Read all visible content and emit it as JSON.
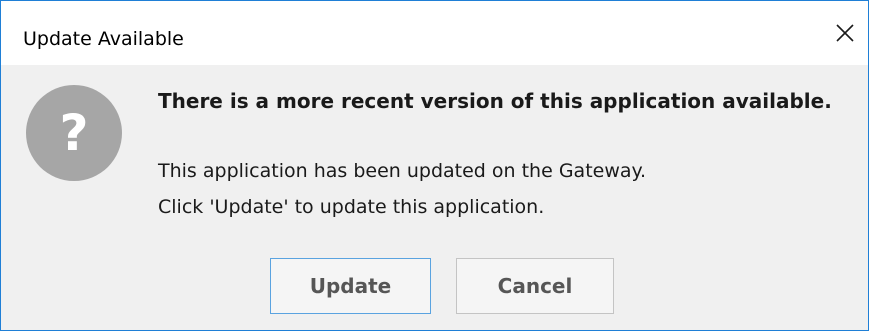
{
  "dialog": {
    "title": "Update Available",
    "close_icon": "close-icon",
    "icon": "question-icon",
    "icon_glyph": "?",
    "headline": "There is a more recent version of this application available.",
    "message_lines": [
      "This application has been updated on the Gateway.",
      "Click 'Update' to update this application."
    ],
    "buttons": {
      "update_label": "Update",
      "cancel_label": "Cancel"
    }
  },
  "colors": {
    "window_border": "#1f7fd6",
    "title_bar_bg": "#ffffff",
    "body_bg": "#f0f0f0",
    "icon_circle": "#a6a6a6",
    "icon_glyph": "#ffffff",
    "default_button_border": "#5aa3e0",
    "button_text": "#565656"
  }
}
